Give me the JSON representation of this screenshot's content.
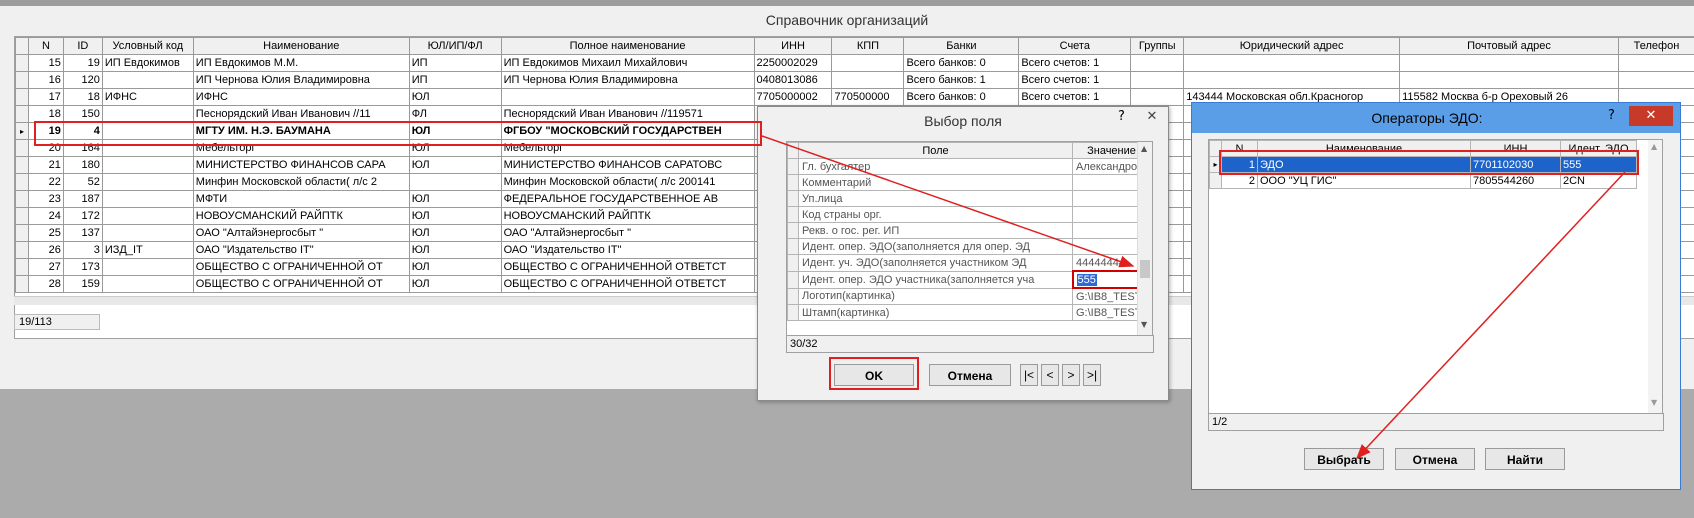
{
  "main": {
    "title": "Справочник организаций",
    "columns": [
      "N",
      "ID",
      "Условный код",
      "Наименование",
      "ЮЛ/ИП/ФЛ",
      "Полное наименование",
      "ИНН",
      "КПП",
      "Банки",
      "Счета",
      "Группы",
      "Юридический адрес",
      "Почтовый адрес",
      "Телефон"
    ],
    "rows": [
      {
        "n": "15",
        "id": "19",
        "code": "ИП Евдокимов",
        "name": "ИП Евдокимов М.М.",
        "type": "ИП",
        "full": "ИП Евдокимов Михаил Михайлович",
        "inn": "2250002029",
        "kpp": "",
        "banks": "Всего банков: 0",
        "accounts": "Всего счетов: 1",
        "groups": "",
        "legal": "",
        "postal": "",
        "phone": ""
      },
      {
        "n": "16",
        "id": "120",
        "code": "",
        "name": "ИП Чернова Юлия Владимировна",
        "type": "ИП",
        "full": "ИП Чернова Юлия Владимировна",
        "inn": "0408013086",
        "kpp": "",
        "banks": "Всего банков: 1",
        "accounts": "Всего счетов: 1",
        "groups": "",
        "legal": "",
        "postal": "",
        "phone": ""
      },
      {
        "n": "17",
        "id": "18",
        "code": "ИФНС",
        "name": "ИФНС",
        "type": "ЮЛ",
        "full": "",
        "inn": "7705000002",
        "kpp": "770500000",
        "banks": "Всего банков: 0",
        "accounts": "Всего счетов: 1",
        "groups": "",
        "legal": "143444 Московская обл.Красногор",
        "postal": "115582 Москва б-р Ореховый 26",
        "phone": ""
      },
      {
        "n": "18",
        "id": "150",
        "code": "",
        "name": "Песнорядский Иван Иванович //11",
        "type": "ФЛ",
        "full": "Песнорядский Иван Иванович //119571",
        "inn": "",
        "kpp": "",
        "banks": "",
        "accounts": "",
        "groups": "",
        "legal": "",
        "postal": "",
        "phone": ""
      },
      {
        "n": "19",
        "id": "4",
        "code": "",
        "name": "МГТУ ИМ. Н.Э. БАУМАНА",
        "type": "ЮЛ",
        "full": "ФГБОУ \"МОСКОВСКИЙ ГОСУДАРСТВЕН",
        "inn": "",
        "kpp": "",
        "banks": "",
        "accounts": "",
        "groups": "",
        "legal": "",
        "postal": "",
        "phone": "43-"
      },
      {
        "n": "20",
        "id": "164",
        "code": "",
        "name": "Мебельторг",
        "type": "ЮЛ",
        "full": "Мебельторг",
        "inn": "",
        "kpp": "",
        "banks": "",
        "accounts": "",
        "groups": "",
        "legal": "",
        "postal": "",
        "phone": ""
      },
      {
        "n": "21",
        "id": "180",
        "code": "",
        "name": "МИНИСТЕРСТВО ФИНАНСОВ САРА",
        "type": "ЮЛ",
        "full": "МИНИСТЕРСТВО ФИНАНСОВ САРАТОВС",
        "inn": "",
        "kpp": "",
        "banks": "",
        "accounts": "",
        "groups": "",
        "legal": "",
        "postal": "",
        "phone": ""
      },
      {
        "n": "22",
        "id": "52",
        "code": "",
        "name": "Минфин Московской области( л/с 2",
        "type": "",
        "full": "Минфин Московской области( л/с 200141",
        "inn": "",
        "kpp": "",
        "banks": "",
        "accounts": "",
        "groups": "",
        "legal": "",
        "postal": "",
        "phone": ""
      },
      {
        "n": "23",
        "id": "187",
        "code": "",
        "name": "МФТИ",
        "type": "ЮЛ",
        "full": "ФЕДЕРАЛЬНОЕ ГОСУДАРСТВЕННОЕ АВ",
        "inn": "",
        "kpp": "",
        "banks": "",
        "accounts": "",
        "groups": "",
        "legal": "",
        "postal": "",
        "phone": ""
      },
      {
        "n": "24",
        "id": "172",
        "code": "",
        "name": "НОВОУСМАНСКИЙ РАЙПТК",
        "type": "ЮЛ",
        "full": "НОВОУСМАНСКИЙ РАЙПТК",
        "inn": "",
        "kpp": "",
        "banks": "",
        "accounts": "",
        "groups": "",
        "legal": "",
        "postal": "",
        "phone": ""
      },
      {
        "n": "25",
        "id": "137",
        "code": "",
        "name": "ОАО \"Алтайэнергосбыт \"",
        "type": "ЮЛ",
        "full": "ОАО \"Алтайэнергосбыт \"",
        "inn": "",
        "kpp": "",
        "banks": "",
        "accounts": "",
        "groups": "",
        "legal": "",
        "postal": "",
        "phone": ""
      },
      {
        "n": "26",
        "id": "3",
        "code": "ИЗД_IT",
        "name": "ОАО \"Издательство IT\"",
        "type": "ЮЛ",
        "full": "ОАО \"Издательство IT\"",
        "inn": "",
        "kpp": "",
        "banks": "",
        "accounts": "",
        "groups": "",
        "legal": "",
        "postal": "",
        "phone": ""
      },
      {
        "n": "27",
        "id": "173",
        "code": "",
        "name": "ОБЩЕСТВО С ОГРАНИЧЕННОЙ ОТ",
        "type": "ЮЛ",
        "full": "ОБЩЕСТВО С ОГРАНИЧЕННОЙ ОТВЕТСТ",
        "inn": "",
        "kpp": "",
        "banks": "",
        "accounts": "",
        "groups": "",
        "legal": "",
        "postal": "",
        "phone": ""
      },
      {
        "n": "28",
        "id": "159",
        "code": "",
        "name": "ОБЩЕСТВО С ОГРАНИЧЕННОЙ ОТ",
        "type": "ЮЛ",
        "full": "ОБЩЕСТВО С ОГРАНИЧЕННОЙ ОТВЕТСТ",
        "inn": "",
        "kpp": "",
        "banks": "",
        "accounts": "",
        "groups": "",
        "legal": "",
        "postal": "",
        "phone": ""
      }
    ],
    "status": "19/113",
    "current_marker": "▸"
  },
  "field_dialog": {
    "title": "Выбор поля",
    "help": "?",
    "close": "✕",
    "columns": [
      "Поле",
      "Значение"
    ],
    "rows": [
      {
        "field": "Гл. бухгалтер",
        "value": "Александров"
      },
      {
        "field": "Комментарий",
        "value": ""
      },
      {
        "field": "Уп.лица",
        "value": ""
      },
      {
        "field": "Код страны орг.",
        "value": ""
      },
      {
        "field": "Рекв. о гос. рег. ИП",
        "value": ""
      },
      {
        "field": "Идент. опер. ЭДО(заполняется для опер. ЭД",
        "value": ""
      },
      {
        "field": "Идент. уч. ЭДО(заполняется участником ЭД",
        "value": "44444444"
      },
      {
        "field": "Идент. опер. ЭДО участника(заполняется уча",
        "value": "555"
      },
      {
        "field": "Логотип(картинка)",
        "value": "G:\\IB8_TEST\\"
      },
      {
        "field": "Штамп(картинка)",
        "value": "G:\\IB8_TEST\\"
      }
    ],
    "status": "30/32",
    "ok": "OK",
    "cancel": "Отмена",
    "nav": [
      "|<",
      "<",
      ">",
      ">|"
    ]
  },
  "operators_dialog": {
    "title": "Операторы ЭДО:",
    "help": "?",
    "close": "✕",
    "columns": [
      "N",
      "Наименование",
      "ИНН",
      "Идент. ЭДО"
    ],
    "rows": [
      {
        "n": "1",
        "name": "ЭДО",
        "inn": "7701102030",
        "ident": "555"
      },
      {
        "n": "2",
        "name": "ООО \"УЦ ГИС\"",
        "inn": "7805544260",
        "ident": "2CN"
      }
    ],
    "status": "1/2",
    "choose": "Выбрать",
    "cancel": "Отмена",
    "find": "Найти"
  },
  "colors": {
    "highlight": "#e02020",
    "selection": "#1e63c9",
    "titlebar": "#5a9ee8",
    "close": "#c73a2a"
  }
}
